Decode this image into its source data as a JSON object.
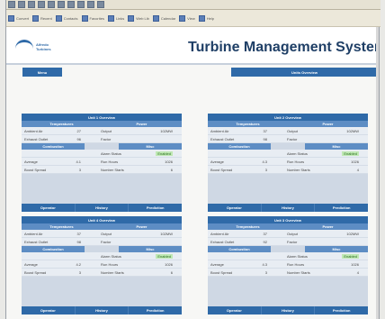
{
  "browser_toolbar": {
    "items": [
      "Convert",
      "Recent",
      "Contacts",
      "Favorites",
      "Links",
      "Web Lib",
      "Calendar",
      "View",
      "Help"
    ]
  },
  "header": {
    "logo_line1": "Alfredo",
    "logo_line2": "Turbines",
    "title": "Turbine Management System"
  },
  "nav": {
    "menu_label": "Menu",
    "units_label": "Units Overview"
  },
  "panels": [
    {
      "title": "Unit 1 Overview",
      "head_left": "Temperatures",
      "head_right": "Power",
      "rows1": [
        {
          "l": "Ambient Air",
          "lv": "27",
          "r": "Output",
          "rv": "102MW"
        },
        {
          "l": "Exhaust Outlet",
          "lv": "96",
          "r": "Factor",
          "rv": ""
        }
      ],
      "misc": "Misc",
      "comb": "Combustion",
      "rows2": [
        {
          "l": "",
          "lv": "",
          "r": "Alarm Status",
          "rv": "Enabled"
        },
        {
          "l": "Average",
          "lv": "4.1",
          "r": "Run Hours",
          "rv": "1026"
        },
        {
          "l": "Boost Spread",
          "lv": "3",
          "r": "Number Starts",
          "rv": "6"
        }
      ],
      "foot": [
        "Operator",
        "History",
        "Prediction"
      ]
    },
    {
      "title": "Unit 2 Overview",
      "head_left": "Temperatures",
      "head_right": "Power",
      "rows1": [
        {
          "l": "Ambient Air",
          "lv": "37",
          "r": "Output",
          "rv": "102MW"
        },
        {
          "l": "Exhaust Outlet",
          "lv": "98",
          "r": "Factor",
          "rv": ""
        }
      ],
      "misc": "Misc",
      "comb": "Combustion",
      "rows2": [
        {
          "l": "",
          "lv": "",
          "r": "Alarm Status",
          "rv": "Enabled"
        },
        {
          "l": "Average",
          "lv": "4.3",
          "r": "Run Hours",
          "rv": "1026"
        },
        {
          "l": "Boost Spread",
          "lv": "3",
          "r": "Number Starts",
          "rv": "4"
        }
      ],
      "foot": [
        "Operator",
        "History",
        "Prediction"
      ]
    },
    {
      "title": "Unit 4 Overview",
      "head_left": "Temperatures",
      "head_right": "Power",
      "rows1": [
        {
          "l": "Ambient Air",
          "lv": "37",
          "r": "Output",
          "rv": "102MW"
        },
        {
          "l": "Exhaust Outlet",
          "lv": "98",
          "r": "Factor",
          "rv": ""
        }
      ],
      "misc": "Misc",
      "comb": "Combustion",
      "rows2": [
        {
          "l": "",
          "lv": "",
          "r": "Alarm Status",
          "rv": "Enabled"
        },
        {
          "l": "Average",
          "lv": "4.2",
          "r": "Run Hours",
          "rv": "1026"
        },
        {
          "l": "Boost Spread",
          "lv": "3",
          "r": "Number Starts",
          "rv": "6"
        }
      ],
      "foot": [
        "Operator",
        "History",
        "Prediction"
      ]
    },
    {
      "title": "Unit 3 Overview",
      "head_left": "Temperatures",
      "head_right": "Power",
      "rows1": [
        {
          "l": "Ambient Air",
          "lv": "37",
          "r": "Output",
          "rv": "102MW"
        },
        {
          "l": "Exhaust Outlet",
          "lv": "92",
          "r": "Factor",
          "rv": ""
        }
      ],
      "misc": "Misc",
      "comb": "Combustion",
      "rows2": [
        {
          "l": "",
          "lv": "",
          "r": "Alarm Status",
          "rv": "Enabled"
        },
        {
          "l": "Average",
          "lv": "4.3",
          "r": "Run Hours",
          "rv": "1026"
        },
        {
          "l": "Boost Spread",
          "lv": "3",
          "r": "Number Starts",
          "rv": "4"
        }
      ],
      "foot": [
        "Operator",
        "History",
        "Prediction"
      ]
    }
  ]
}
